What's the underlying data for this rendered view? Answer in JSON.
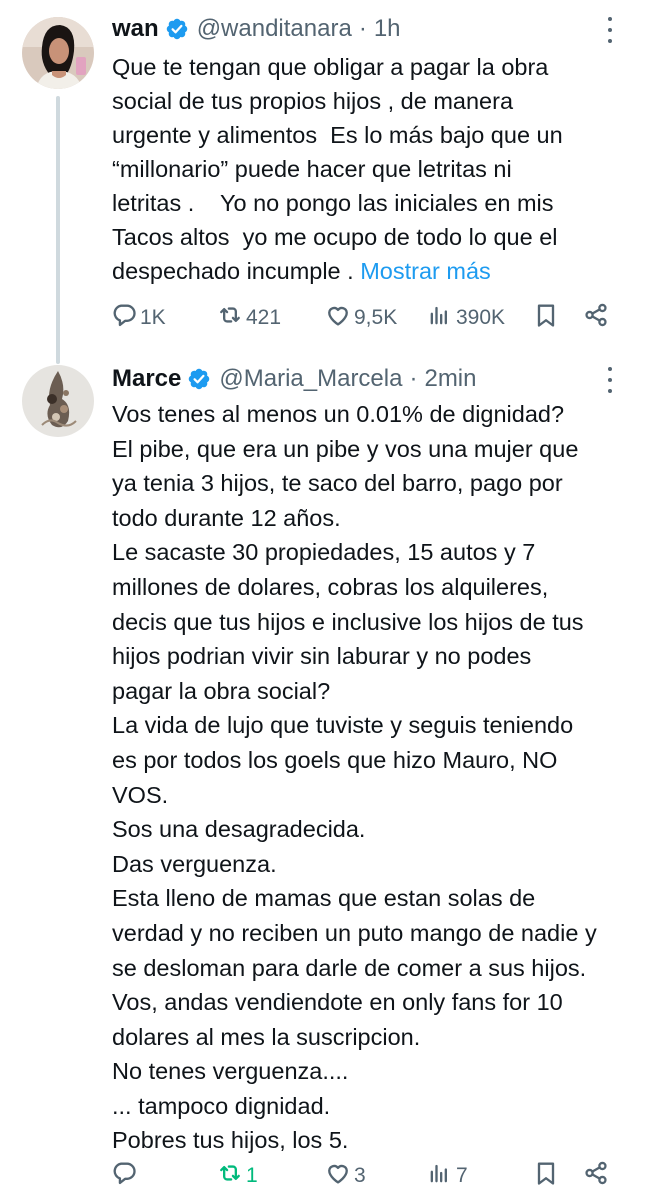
{
  "tweets": [
    {
      "author_name": "wan",
      "handle": "@wanditanara",
      "separator": "·",
      "time": "1h",
      "text_lines": [
        "Que te tengan que obligar a pagar la obra",
        "social de tus propios hijos , de manera",
        "urgente y alimentos  Es lo más bajo que un",
        "“millonario” puede hacer que letritas ni",
        "letritas .    Yo no pongo las iniciales en mis",
        "Tacos altos  yo me ocupo de todo lo que el",
        "despechado incumple . "
      ],
      "show_more_label": "Mostrar más",
      "replies": "1K",
      "reposts": "421",
      "likes": "9,5K",
      "views": "390K"
    },
    {
      "author_name": "Marce",
      "handle": "@Maria_Marcela",
      "separator": "·",
      "time": "2min",
      "text_lines": [
        "Vos tenes al menos un 0.01% de dignidad?",
        "El pibe, que era un pibe y vos una mujer que",
        "ya tenia 3 hijos, te saco del barro, pago por",
        "todo durante 12 años.",
        "Le sacaste 30 propiedades, 15 autos y 7",
        "millones de dolares, cobras los alquileres,",
        "decis que tus hijos e inclusive los hijos de tus",
        "hijos podrian vivir sin laburar y no podes",
        "pagar la obra social?",
        "La vida de lujo que tuviste y seguis teniendo",
        "es por todos los goels que hizo Mauro, NO",
        "VOS.",
        "Sos una desagradecida.",
        "Das verguenza.",
        "Esta lleno de mamas que estan solas de",
        "verdad y no reciben un puto mango de nadie y",
        "se desloman para darle de comer a sus hijos.",
        "Vos, andas vendiendote en only fans for 10",
        "dolares al mes la suscripcion.",
        "No tenes verguenza....",
        "... tampoco dignidad.",
        "Pobres tus hijos, los 5."
      ],
      "replies": "",
      "reposts": "1",
      "likes": "3",
      "views": "7"
    }
  ],
  "icons": {
    "verified": "verified-badge-icon",
    "more": "more-options-icon",
    "reply": "reply-icon",
    "repost": "repost-icon",
    "like": "like-icon",
    "views": "views-icon",
    "bookmark": "bookmark-icon",
    "share": "share-icon"
  },
  "colors": {
    "text": "#0f1419",
    "secondary": "#536471",
    "link": "#1d9bf0",
    "verified": "#1d9bf0",
    "repost_active": "#00ba7c",
    "thread_line": "#cfd9de"
  }
}
